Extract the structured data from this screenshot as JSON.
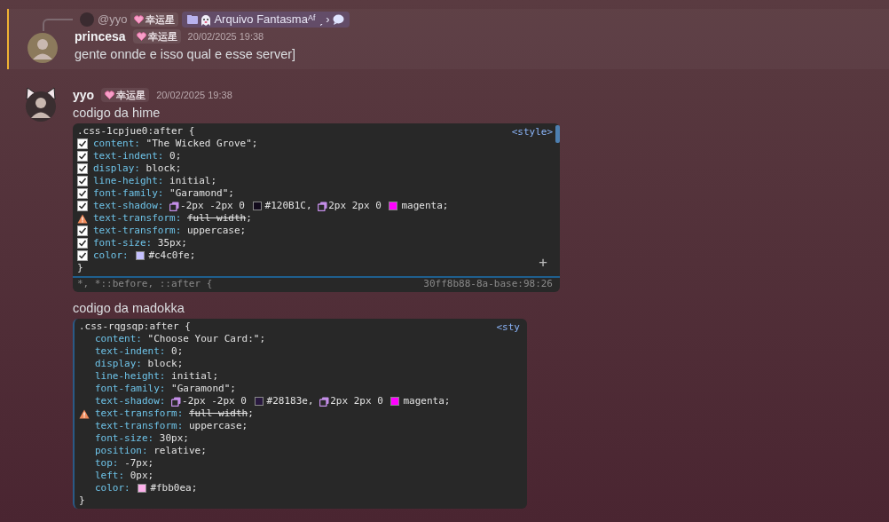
{
  "reply": {
    "author": "@yyo",
    "tag": "幸运星",
    "snippet": "Arquivo Fantasmaᴬᶠ ˏ ›"
  },
  "messages": [
    {
      "author": "princesa",
      "tag": "幸运星",
      "time": "20/02/2025 19:38",
      "mentioned": true,
      "avatar": {
        "kind": "plain"
      },
      "content": [
        {
          "kind": "text",
          "text": "gente onnde e isso qual e esse server]"
        }
      ]
    },
    {
      "author": "yyo",
      "tag": "幸运星",
      "time": "20/02/2025 19:38",
      "mentioned": false,
      "avatar": {
        "kind": "cat_ears"
      },
      "content": [
        {
          "kind": "text",
          "text": "codigo da hime"
        },
        {
          "kind": "code",
          "link": "<style>",
          "add": "+",
          "scrollbar": true,
          "selector": ".css-1cpjue0:after {",
          "close": "}",
          "next_rule": "*, *::before, ::after {",
          "next_source": "30ff8b88-8a-base:98:26",
          "declarations": [
            {
              "kind": "checkbox",
              "checked": true,
              "property": "content:",
              "value": [
                {
                  "kind": "text",
                  "text": "\"The Wicked Grove\";"
                }
              ]
            },
            {
              "kind": "checkbox",
              "checked": true,
              "property": "text-indent:",
              "value": [
                {
                  "kind": "text",
                  "text": "0;"
                }
              ]
            },
            {
              "kind": "checkbox",
              "checked": true,
              "property": "display:",
              "value": [
                {
                  "kind": "text",
                  "text": "block;"
                }
              ]
            },
            {
              "kind": "checkbox",
              "checked": true,
              "property": "line-height:",
              "value": [
                {
                  "kind": "text",
                  "text": "initial;"
                }
              ]
            },
            {
              "kind": "checkbox",
              "checked": true,
              "property": "font-family:",
              "value": [
                {
                  "kind": "text",
                  "text": "\"Garamond\";"
                }
              ]
            },
            {
              "kind": "checkbox",
              "checked": true,
              "property": "text-shadow:",
              "value": [
                {
                  "kind": "shadow"
                },
                {
                  "kind": "text",
                  "text": "-2px -2px 0"
                },
                {
                  "kind": "swatch",
                  "color": "#120b1c"
                },
                {
                  "kind": "text",
                  "text": "#120B1C,"
                },
                {
                  "kind": "shadow"
                },
                {
                  "kind": "text",
                  "text": "2px 2px 0"
                },
                {
                  "kind": "swatch",
                  "color": "#ff00ff"
                },
                {
                  "kind": "text",
                  "text": "magenta;"
                }
              ]
            },
            {
              "kind": "warning",
              "property": "text-transform:",
              "value": [
                {
                  "kind": "text",
                  "text": "full width",
                  "struck": true
                },
                {
                  "kind": "text",
                  "text": ";"
                }
              ]
            },
            {
              "kind": "checkbox",
              "checked": true,
              "property": "text-transform:",
              "value": [
                {
                  "kind": "text",
                  "text": "uppercase;"
                }
              ]
            },
            {
              "kind": "checkbox",
              "checked": true,
              "property": "font-size:",
              "value": [
                {
                  "kind": "text",
                  "text": "35px;"
                }
              ]
            },
            {
              "kind": "checkbox",
              "checked": true,
              "property": "color:",
              "value": [
                {
                  "kind": "swatch",
                  "color": "#c4c0fe"
                },
                {
                  "kind": "text",
                  "text": "#c4c0fe;"
                }
              ]
            }
          ]
        },
        {
          "kind": "text",
          "text": "codigo da madokka"
        },
        {
          "kind": "code",
          "link": "<sty",
          "scrollbar": false,
          "selector": ".css-rqgsqp:after {",
          "close": "}",
          "declarations": [
            {
              "kind": "plain",
              "property": "content:",
              "value": [
                {
                  "kind": "text",
                  "text": "\"Choose Your Card:\";"
                }
              ]
            },
            {
              "kind": "plain",
              "property": "text-indent:",
              "value": [
                {
                  "kind": "text",
                  "text": "0;"
                }
              ]
            },
            {
              "kind": "plain",
              "property": "display:",
              "value": [
                {
                  "kind": "text",
                  "text": "block;"
                }
              ]
            },
            {
              "kind": "plain",
              "property": "line-height:",
              "value": [
                {
                  "kind": "text",
                  "text": "initial;"
                }
              ]
            },
            {
              "kind": "plain",
              "property": "font-family:",
              "value": [
                {
                  "kind": "text",
                  "text": "\"Garamond\";"
                }
              ]
            },
            {
              "kind": "plain",
              "property": "text-shadow:",
              "value": [
                {
                  "kind": "shadow"
                },
                {
                  "kind": "text",
                  "text": "-2px -2px 0"
                },
                {
                  "kind": "swatch",
                  "color": "#28183e"
                },
                {
                  "kind": "text",
                  "text": "#28183e,"
                },
                {
                  "kind": "shadow"
                },
                {
                  "kind": "text",
                  "text": "2px 2px 0"
                },
                {
                  "kind": "swatch",
                  "color": "#ff00ff"
                },
                {
                  "kind": "text",
                  "text": "magenta;"
                }
              ]
            },
            {
              "kind": "warning",
              "property": "text-transform:",
              "value": [
                {
                  "kind": "text",
                  "text": "full width",
                  "struck": true
                },
                {
                  "kind": "text",
                  "text": ";"
                }
              ]
            },
            {
              "kind": "plain",
              "property": "text-transform:",
              "value": [
                {
                  "kind": "text",
                  "text": "uppercase;"
                }
              ]
            },
            {
              "kind": "plain",
              "property": "font-size:",
              "value": [
                {
                  "kind": "text",
                  "text": "30px;"
                }
              ]
            },
            {
              "kind": "plain",
              "property": "position:",
              "value": [
                {
                  "kind": "text",
                  "text": "relative;"
                }
              ]
            },
            {
              "kind": "plain",
              "property": "top:",
              "value": [
                {
                  "kind": "text",
                  "text": "-7px;"
                }
              ]
            },
            {
              "kind": "plain",
              "property": "left:",
              "value": [
                {
                  "kind": "text",
                  "text": "0px;"
                }
              ]
            },
            {
              "kind": "plain",
              "property": "color:",
              "value": [
                {
                  "kind": "swatch",
                  "color": "#fbb0ea"
                },
                {
                  "kind": "text",
                  "text": "#fbb0ea;"
                }
              ]
            }
          ]
        }
      ]
    }
  ]
}
